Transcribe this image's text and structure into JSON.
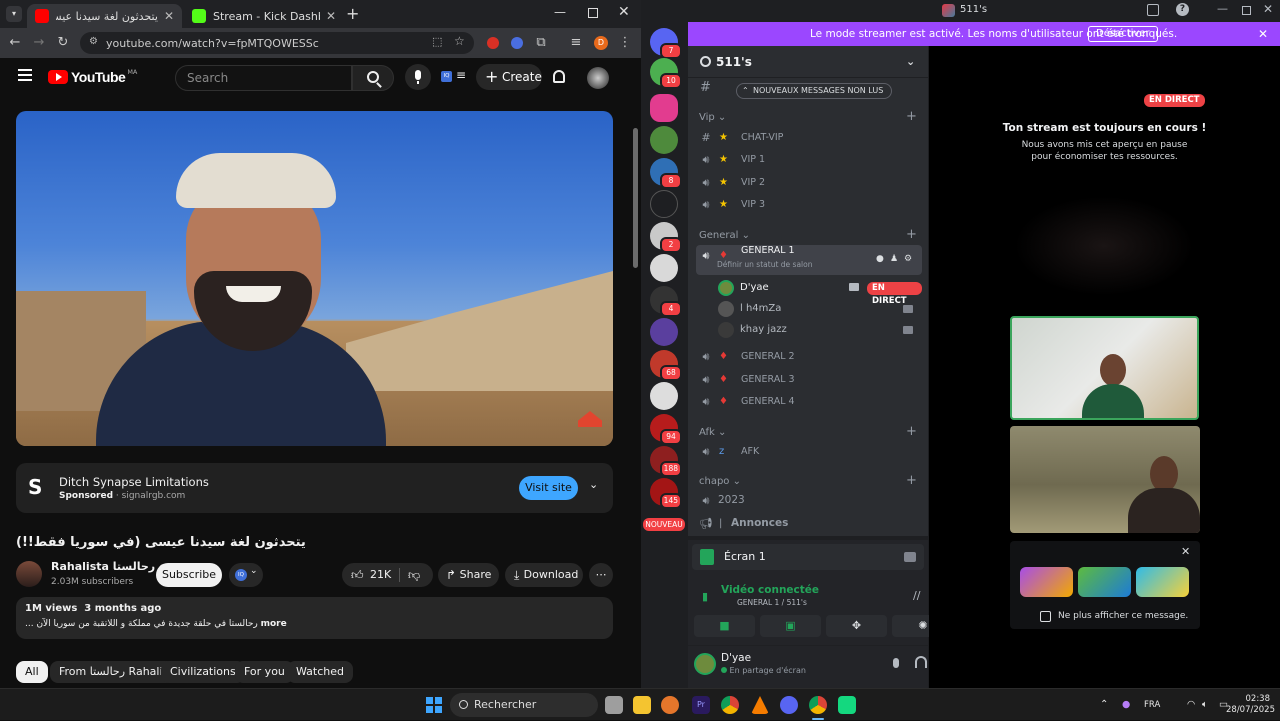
{
  "colors": {
    "youtube_red": "#ff0000",
    "discord_purple": "#9b47ff",
    "live_red": "#ed4245",
    "kick_green": "#53fc18",
    "subscribe_white": "#f1f1f1",
    "visit_blue": "#3ea6ff"
  },
  "chrome": {
    "tabs": [
      {
        "title": "يتحدثون لغة سيدنا عيسى (في",
        "icon": "youtube-favicon"
      },
      {
        "title": "Stream - Kick Dashboard",
        "icon": "kick-favicon"
      }
    ],
    "url": "youtube.com/watch?v=fpMTQOWESSc"
  },
  "youtube": {
    "logo_text": "YouTube",
    "logo_region": "MA",
    "search_placeholder": "Search",
    "create_label": "Create",
    "ad": {
      "title": "Ditch Synapse Limitations",
      "sponsored": "Sponsored",
      "domain": "signalrgb.com",
      "cta": "Visit site"
    },
    "video_title": "يتحدثون لغة سيدنا عيسى (في سوريا فقط!!)",
    "channel": {
      "name": "Rahalista رحالستا",
      "subscribers": "2.03M subscribers",
      "subscribe_label": "Subscribe"
    },
    "likes": "21K",
    "share_label": "Share",
    "download_label": "Download",
    "views_line": "1M views  3 months ago",
    "description_line": "رحالستا في حلقة جديدة في مملكة و اللاتقبة من سوريا الآن ...",
    "more_label": "more",
    "chips": [
      "All",
      "From رحالستا Rahalista",
      "Civilizations",
      "For you",
      "Watched"
    ]
  },
  "discord": {
    "title": "511's",
    "streamer_mode_text": "Le mode streamer est activé. Les noms d'utilisateur ont été tronqués.",
    "deactivate_label": "Désactiver",
    "server_name": "511's",
    "new_messages_label": "NOUVEAUX MESSAGES NON LUS",
    "guild_badges": [
      "7",
      "10",
      "8",
      "2",
      "4",
      "68",
      "94",
      "188",
      "145"
    ],
    "guild_new_label": "NOUVEAU",
    "categories": {
      "vip": "Vip",
      "general": "General",
      "afk": "Afk",
      "chapo": "chapo"
    },
    "vip_channels": [
      "CHAT-VIP",
      "VIP 1",
      "VIP 2",
      "VIP 3"
    ],
    "general_1": {
      "name": "GENERAL 1",
      "status": "Définir un statut de salon"
    },
    "voice_users": [
      {
        "name": "D'yae",
        "live": "EN DIRECT"
      },
      {
        "name": "l h4mZa"
      },
      {
        "name": "khay jazz"
      }
    ],
    "general_channels": [
      "GENERAL 2",
      "GENERAL 3",
      "GENERAL 4"
    ],
    "afk_channel": "AFK",
    "chapo_channels": [
      "2023",
      "Annonces"
    ],
    "screen_share": {
      "label": "Écran 1"
    },
    "voice_connected": {
      "title": "Vidéo connectée",
      "subtitle": "GENERAL 1 / 511's"
    },
    "user": {
      "name": "D'yae",
      "status": "En partage d'écran"
    },
    "stream": {
      "live_badge": "EN DIRECT",
      "title": "Ton stream est toujours en cours !",
      "subtitle": "Nous avons mis cet aperçu en pause pour économiser tes ressources.",
      "dont_show": "Ne plus afficher ce message."
    }
  },
  "taskbar": {
    "search_label": "Rechercher",
    "lang": "FRA",
    "time": "02:38",
    "date": "28/07/2025"
  }
}
